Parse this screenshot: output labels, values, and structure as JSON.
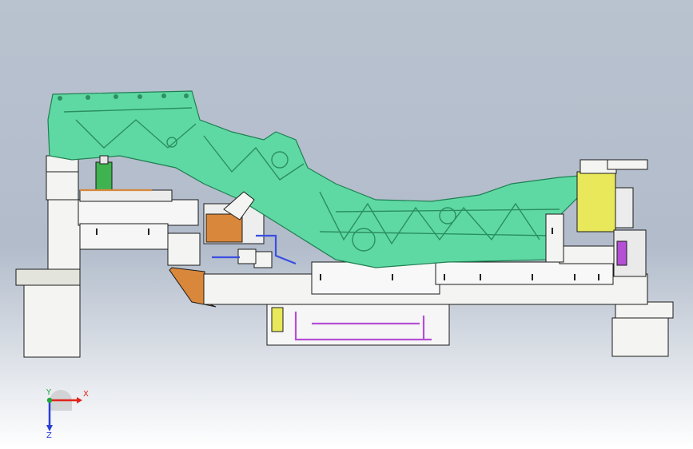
{
  "viewport": {
    "background_top": "#b9c2cf",
    "background_bottom": "#ffffff"
  },
  "colors": {
    "casting_fill": "#5fd9a3",
    "casting_edge": "#1f7f52",
    "fixture_base": "#f4f4f2",
    "edge": "#1b1b1b",
    "clamp_yellow": "#e8e85a",
    "bracket_orange": "#d9873a",
    "piping_blue": "#3a4fe0",
    "piping_magenta": "#b44fd6",
    "sensor_green": "#3fb34f"
  },
  "triad": {
    "x_label": "X",
    "y_label": "Y",
    "z_label": "Z",
    "x_color": "#e2231a",
    "y_color": "#1fa83a",
    "z_color": "#2a3fd8"
  }
}
